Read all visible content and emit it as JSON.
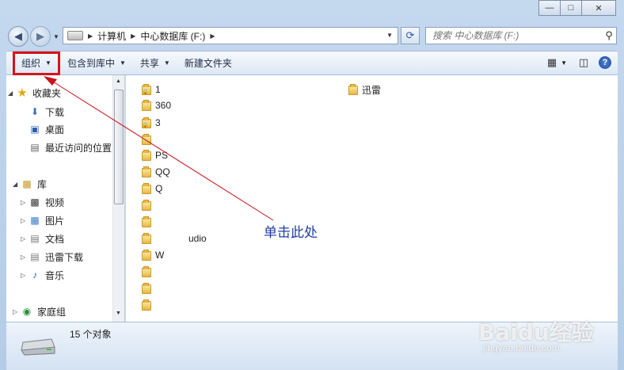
{
  "window": {
    "caption_buttons": [
      "minimize",
      "maximize",
      "close"
    ],
    "address": {
      "breadcrumbs": [
        "计算机",
        "中心数据库 (F:)"
      ]
    },
    "search": {
      "placeholder": "搜索 中心数据库 (F:)"
    }
  },
  "toolbar": {
    "organize": "组织",
    "include_library": "包含到库中",
    "share": "共享",
    "new_folder": "新建文件夹"
  },
  "nav": {
    "favorites": "收藏夹",
    "favorites_items": [
      "下载",
      "桌面",
      "最近访问的位置"
    ],
    "libraries": "库",
    "library_items": [
      "视频",
      "图片",
      "文档",
      "迅雷下载",
      "音乐"
    ],
    "homegroup": "家庭组"
  },
  "files": [
    {
      "name": "1"
    },
    {
      "name": "360"
    },
    {
      "name": "3"
    },
    {
      "name": ""
    },
    {
      "name": "PS"
    },
    {
      "name": "QQ"
    },
    {
      "name": "Q"
    },
    {
      "name": ""
    },
    {
      "name": ""
    },
    {
      "name": "udio"
    },
    {
      "name": "W"
    },
    {
      "name": ""
    },
    {
      "name": ""
    },
    {
      "name": ""
    },
    {
      "name": "迅雷"
    }
  ],
  "status": {
    "count_text": "15 个对象"
  },
  "annotation": {
    "text": "单击此处"
  },
  "watermark": {
    "brand": "Baidu经验",
    "url": "jingyan.baidu.com"
  },
  "colors": {
    "highlight": "#d4141a",
    "annotation": "#1f3ea3"
  }
}
